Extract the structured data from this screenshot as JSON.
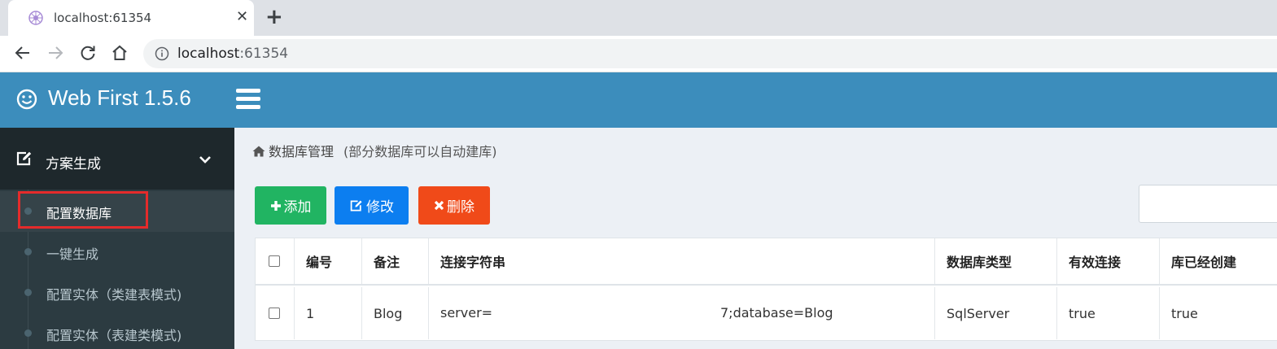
{
  "browser": {
    "tab_title": "localhost:61354",
    "tab_close_glyph": "✕",
    "new_tab_glyph": "+",
    "url_host": "localhost",
    "url_port": ":61354",
    "icons": [
      "back-icon",
      "forward-icon",
      "reload-icon",
      "home-icon",
      "info-icon",
      "favicon-icon"
    ]
  },
  "header": {
    "brand": "Web First 1.5.6",
    "brand_icon": "smile-icon",
    "menu_icon": "hamburger-icon",
    "color": "#3c8dbc"
  },
  "sidebar": {
    "group": {
      "label": "方案生成",
      "icon": "edit-icon",
      "chevron": "chevron-down-icon"
    },
    "items": [
      {
        "label": "配置数据库",
        "active": true
      },
      {
        "label": "一键生成",
        "active": false
      },
      {
        "label": "配置实体（类建表模式)",
        "active": false
      },
      {
        "label": "配置实体（表建类模式)",
        "active": false
      }
    ]
  },
  "breadcrumb": {
    "title": "数据库管理",
    "subtitle": "(部分数据库可以自动建库)"
  },
  "buttons": {
    "add": "添加",
    "edit": "修改",
    "delete": "删除",
    "colors": {
      "add": "#21b462",
      "edit": "#0c7ef0",
      "delete": "#f04a19"
    }
  },
  "table": {
    "columns": [
      "编号",
      "备注",
      "连接字符串",
      "数据库类型",
      "有效连接",
      "库已经创建"
    ],
    "rows": [
      {
        "id": "1",
        "remark": "Blog",
        "conn_start": "server=",
        "conn_end": "7;database=Blog",
        "db_type": "SqlServer",
        "valid": "true",
        "created": "true"
      }
    ]
  }
}
